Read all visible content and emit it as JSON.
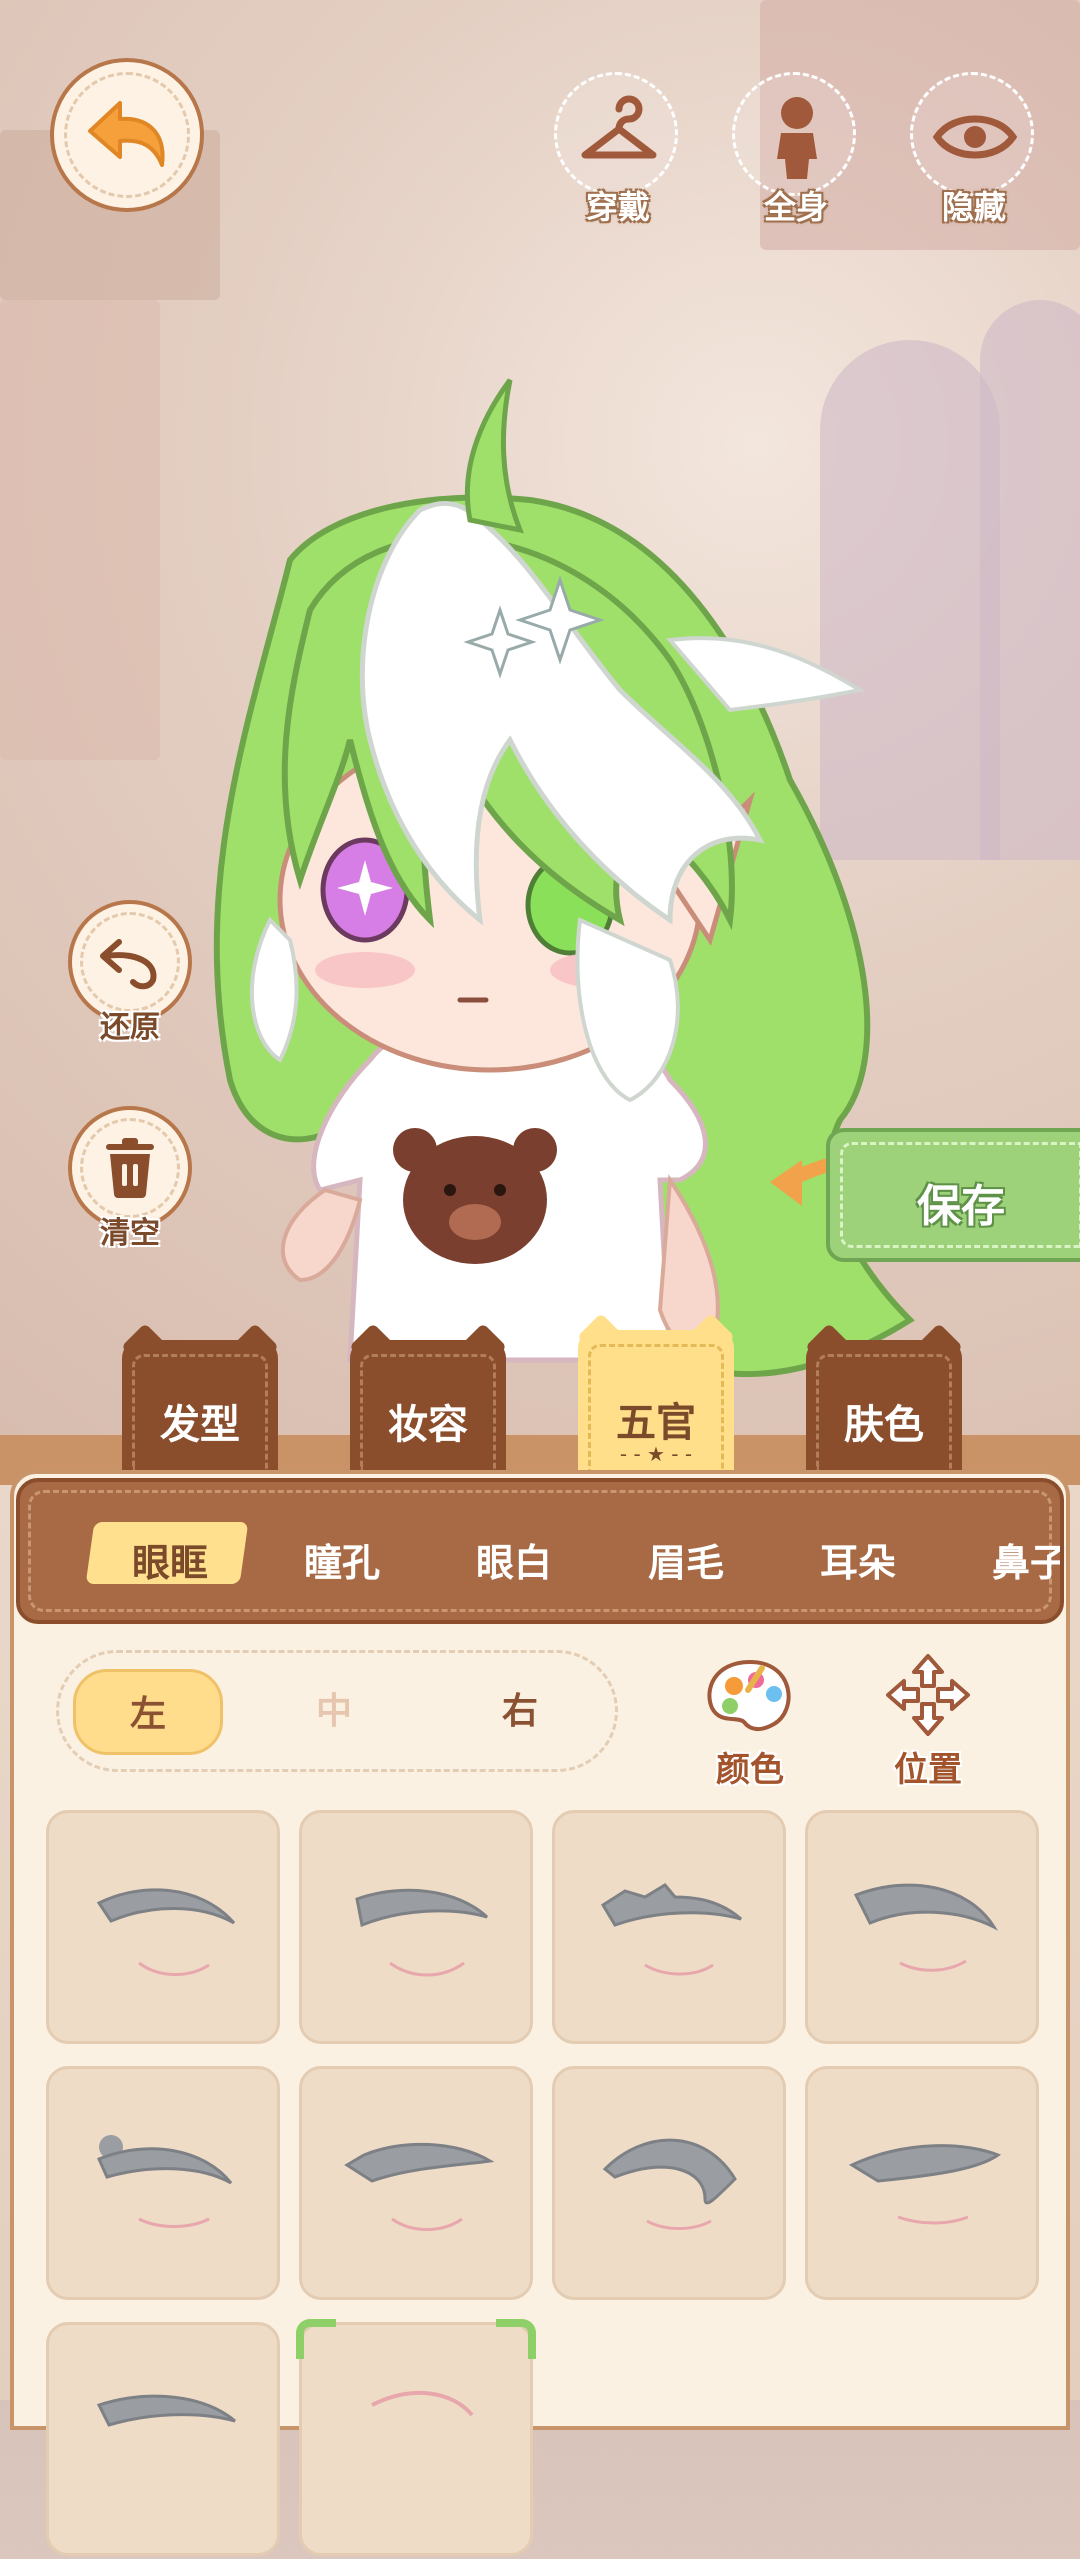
{
  "top_bar": {
    "wear_label": "穿戴",
    "fullbody_label": "全身",
    "hide_label": "隐藏"
  },
  "side": {
    "restore_label": "还原",
    "clear_label": "清空"
  },
  "save_label": "保存",
  "categories": [
    {
      "label": "发型",
      "active": false
    },
    {
      "label": "妆容",
      "active": false
    },
    {
      "label": "五官",
      "active": true
    },
    {
      "label": "肤色",
      "active": false
    }
  ],
  "subcategories": [
    {
      "label": "眼眶",
      "active": true
    },
    {
      "label": "瞳孔",
      "active": false
    },
    {
      "label": "眼白",
      "active": false
    },
    {
      "label": "眉毛",
      "active": false
    },
    {
      "label": "耳朵",
      "active": false
    },
    {
      "label": "鼻子",
      "active": false
    }
  ],
  "side_selector": {
    "left": "左",
    "middle": "中",
    "right": "右",
    "selected": "左"
  },
  "tools": {
    "color_label": "颜色",
    "position_label": "位置"
  },
  "colors": {
    "brown": "#8a4e2d",
    "cream": "#fbf1e2",
    "yellow_active": "#ffdf8a",
    "green_save": "#9dd17a",
    "hair_green": "#9ee06a"
  }
}
